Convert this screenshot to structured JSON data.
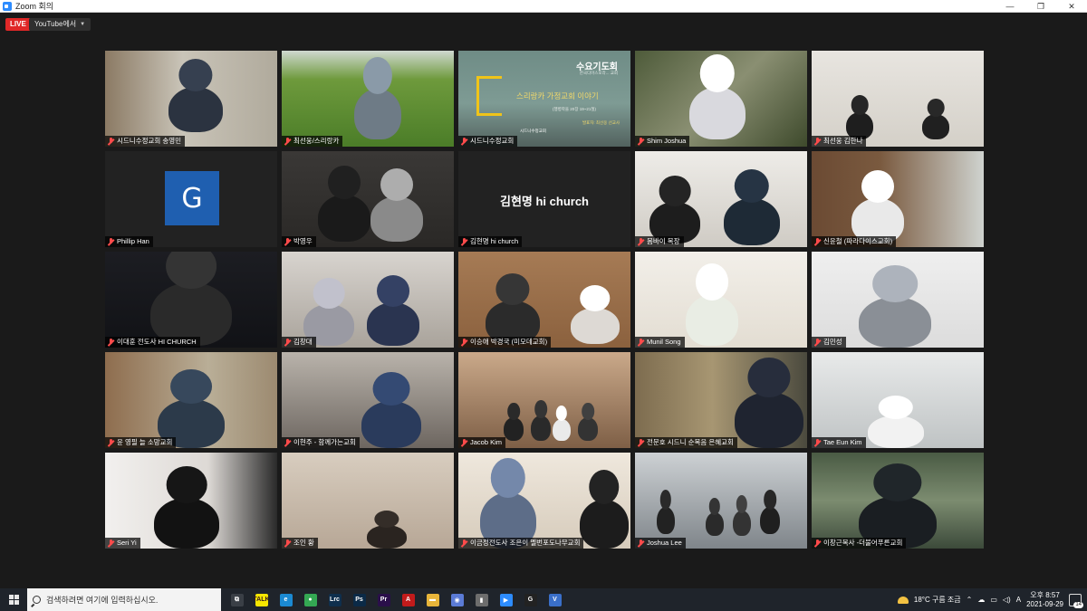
{
  "window": {
    "title": "Zoom 회의",
    "controls": [
      "—",
      "❐",
      "✕"
    ]
  },
  "meeting": {
    "live_label": "LIVE",
    "stream_label": "YouTube에서",
    "slide": {
      "title": "수요기도회",
      "subtitle": "한국디아스포라... 교회",
      "main": "스리랑카 가정교회 이야기",
      "note": "(행병학을 20장 19~21절)",
      "speaker": "발표자: 최선웅 선교사",
      "church": "시드니수정교회"
    },
    "avatar_letter": "G",
    "center_name": "김현명 hi church",
    "participants": [
      {
        "name": "시드니수정교회 송영민",
        "scene": "bookshelf"
      },
      {
        "name": "최선웅/스리랑카",
        "scene": "tea"
      },
      {
        "name": "시드니수정교회",
        "scene": "slide"
      },
      {
        "name": "Shim Joshua",
        "scene": "rocks"
      },
      {
        "name": "최선웅 김한나",
        "scene": "room-light"
      },
      {
        "name": "Phillip Han",
        "scene": "avatar"
      },
      {
        "name": "박영우",
        "scene": "couple-dark"
      },
      {
        "name": "김현명 hi church",
        "scene": "name-only"
      },
      {
        "name": "몸바이 목장",
        "scene": "couple-light"
      },
      {
        "name": "신윤철 (파라다이스교회)",
        "scene": "door"
      },
      {
        "name": "이대훈 전도사 HI CHURCH",
        "scene": "dark-clap"
      },
      {
        "name": "김창대",
        "scene": "couple-wall"
      },
      {
        "name": "이승애 박경국 (미모데교회)",
        "scene": "wood"
      },
      {
        "name": "Munil Song",
        "scene": "bright-room"
      },
      {
        "name": "김민성",
        "scene": "white-wall"
      },
      {
        "name": "윤 영필 늘 소망교회",
        "scene": "shelf-man"
      },
      {
        "name": "이현주 - 함께가는교회",
        "scene": "kitchen"
      },
      {
        "name": "Jacob Kim",
        "scene": "family"
      },
      {
        "name": "전문호 시드니 순복음 은혜교회",
        "scene": "painting"
      },
      {
        "name": "Tae Eun Kim",
        "scene": "window"
      },
      {
        "name": "Seri Yi",
        "scene": "girl"
      },
      {
        "name": "조인 황",
        "scene": "lamp"
      },
      {
        "name": "이금정전도사 조은이 멜번포도나무교회",
        "scene": "clap-two"
      },
      {
        "name": "Joshua Lee",
        "scene": "group"
      },
      {
        "name": "이창근목사 -더불어푸른교회",
        "scene": "man-blur"
      }
    ]
  },
  "taskbar": {
    "search_placeholder": "검색하려면 여기에 입력하십시오.",
    "weather": "18°C  구름 조금",
    "ime": "A",
    "time": "오후 8:57",
    "date": "2021-09-29",
    "notifications": "14",
    "apps": [
      {
        "name": "task-view",
        "label": "⧉",
        "color": "#3a3f46"
      },
      {
        "name": "kakaotalk",
        "label": "TALK",
        "color": "#f7e600"
      },
      {
        "name": "edge",
        "label": "e",
        "color": "#1b8ad3"
      },
      {
        "name": "chrome",
        "label": "●",
        "color": "#34a853"
      },
      {
        "name": "lightroom",
        "label": "Lrc",
        "color": "#0f2f4d"
      },
      {
        "name": "photoshop",
        "label": "Ps",
        "color": "#0b2a47"
      },
      {
        "name": "premiere",
        "label": "Pr",
        "color": "#2a0f4a"
      },
      {
        "name": "acrobat",
        "label": "A",
        "color": "#c21b1b"
      },
      {
        "name": "explorer",
        "label": "▬",
        "color": "#e8b53a"
      },
      {
        "name": "camera",
        "label": "◉",
        "color": "#5b7bd6"
      },
      {
        "name": "usb",
        "label": "▮",
        "color": "#6d6d6d"
      },
      {
        "name": "zoom",
        "label": "▶",
        "color": "#2d8cff"
      },
      {
        "name": "g-app",
        "label": "G",
        "color": "#222222"
      },
      {
        "name": "v-app",
        "label": "V",
        "color": "#3a6fc9"
      }
    ]
  }
}
